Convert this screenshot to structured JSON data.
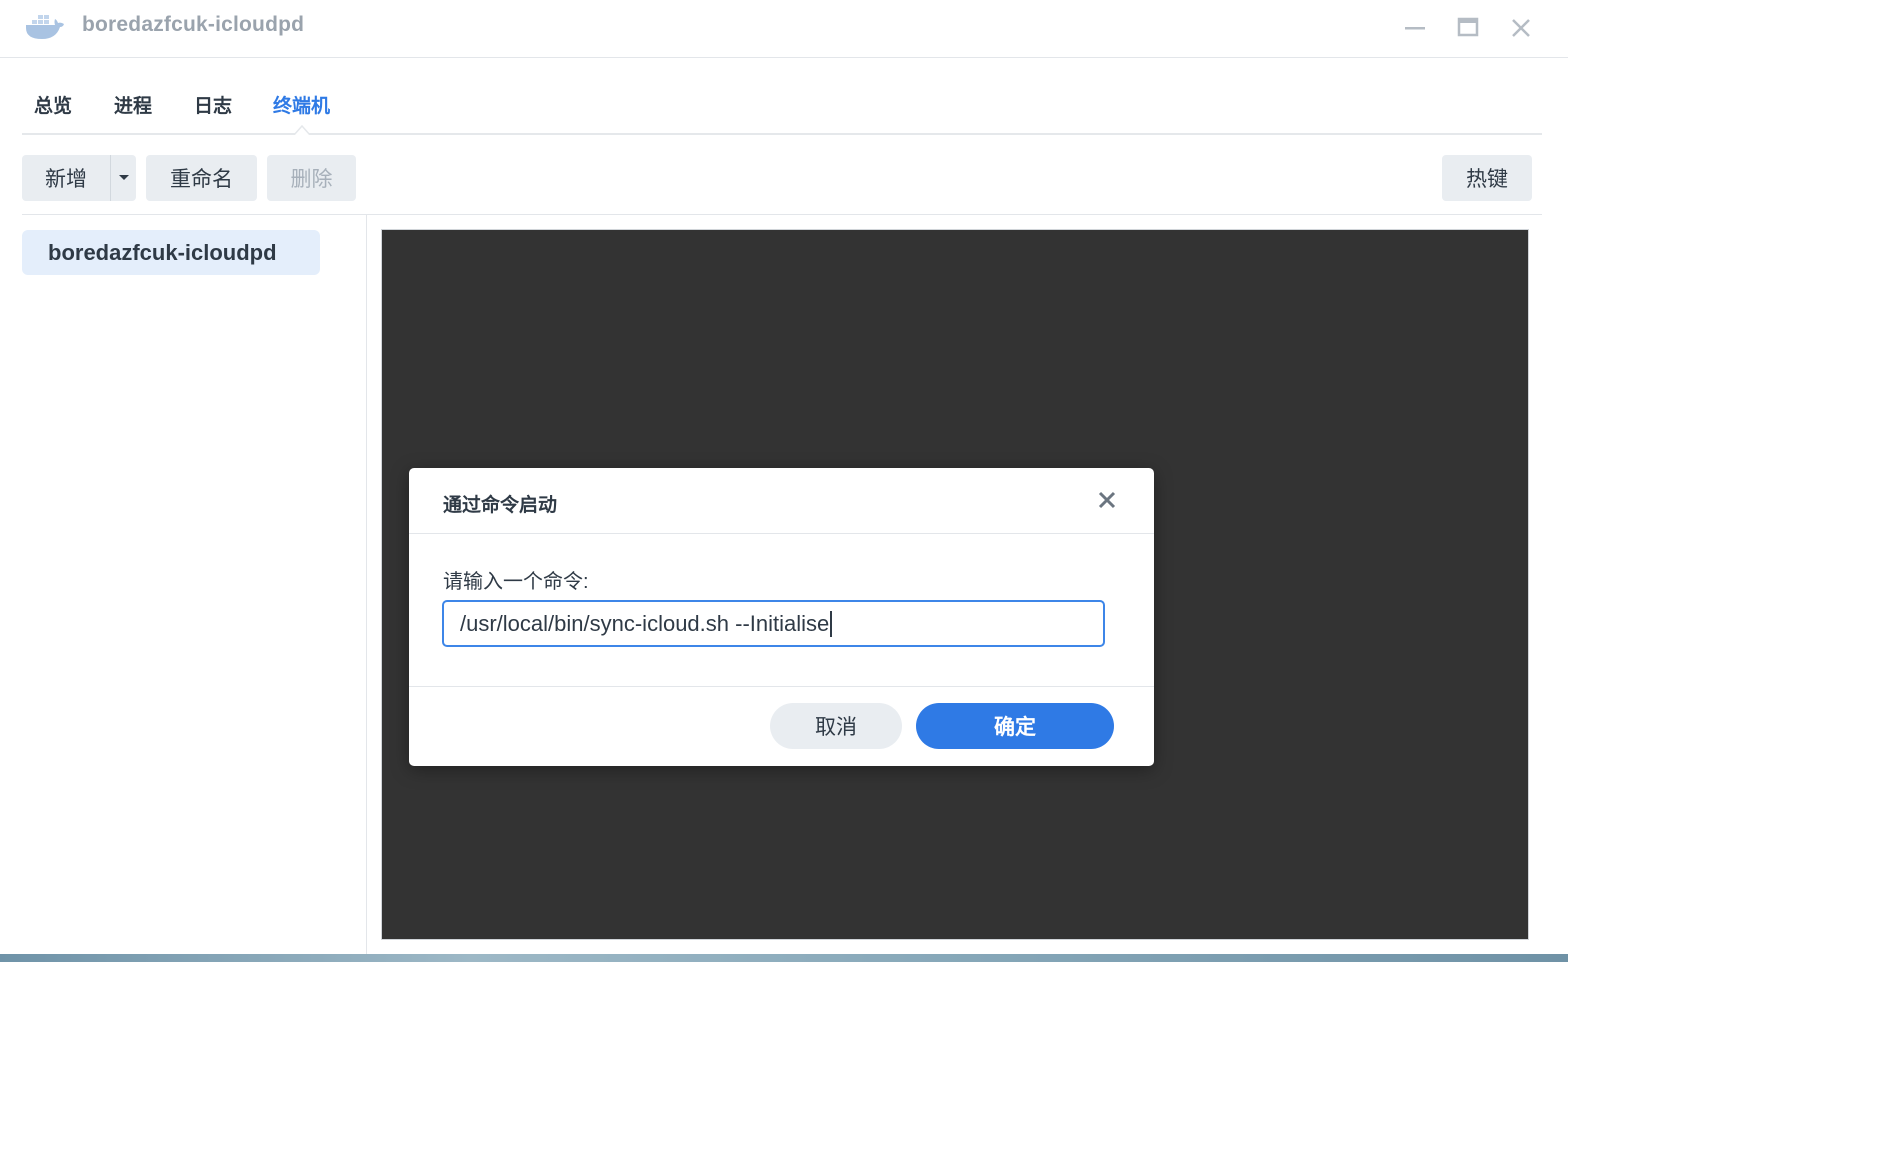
{
  "window": {
    "title": "boredazfcuk-icloudpd",
    "icon": "docker-whale-icon"
  },
  "tabs": [
    {
      "label": "总览",
      "active": false
    },
    {
      "label": "进程",
      "active": false
    },
    {
      "label": "日志",
      "active": false
    },
    {
      "label": "终端机",
      "active": true
    }
  ],
  "toolbar": {
    "new_label": "新增",
    "rename_label": "重命名",
    "delete_label": "删除",
    "hotkey_label": "热键"
  },
  "sessions": [
    {
      "label": "boredazfcuk-icloudpd",
      "selected": true
    }
  ],
  "dialog": {
    "title": "通过命令启动",
    "prompt_label": "请输入一个命令:",
    "command_value": "/usr/local/bin/sync-icloud.sh --Initialise",
    "cancel_label": "取消",
    "ok_label": "确定"
  },
  "colors": {
    "accent": "#2f7ae5",
    "terminal_bg": "#333333",
    "selected_item_bg": "#e4eefb"
  }
}
